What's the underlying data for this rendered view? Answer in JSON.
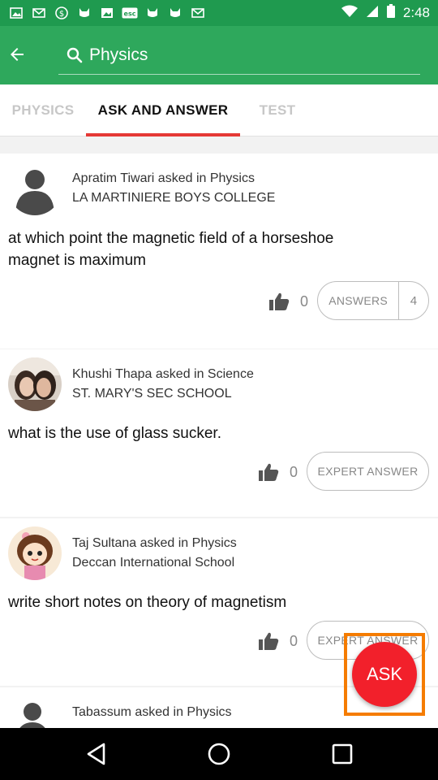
{
  "status_bar": {
    "time": "2:48",
    "left_icons": [
      "gallery-icon",
      "mail-icon",
      "dollar-icon",
      "cat-icon",
      "photo-icon",
      "esc-icon",
      "cat-icon",
      "cat-icon",
      "mail-icon"
    ],
    "right_icons": [
      "wifi-icon",
      "signal-icon",
      "battery-icon"
    ]
  },
  "search": {
    "value": "Physics",
    "placeholder": "Physics"
  },
  "tabs": [
    {
      "label": "PHYSICS",
      "active": false
    },
    {
      "label": "ASK AND ANSWER",
      "active": true
    },
    {
      "label": "TEST",
      "active": false
    }
  ],
  "colors": {
    "status_bar": "#1f9a4f",
    "app_bar": "#2ea85c",
    "tab_indicator": "#e53935",
    "ask_button": "#f2202b",
    "highlight_frame": "#f57c00"
  },
  "posts": [
    {
      "asker": "Apratim Tiwari asked in Physics",
      "school": "LA MARTINIERE BOYS COLLEGE",
      "question_line1": "at which point the magnetic field of a horseshoe",
      "question_line2": "magnet is maximum",
      "likes": "0",
      "answers_label": "ANSWERS",
      "answers_count": "4",
      "avatar": "default-person-icon"
    },
    {
      "asker": "Khushi Thapa asked in Science",
      "school": "ST. MARY'S SEC SCHOOL",
      "question": "what is the use of glass sucker.",
      "likes": "0",
      "button_label": "EXPERT ANSWER",
      "avatar": "photo-avatar"
    },
    {
      "asker": "Taj Sultana asked in Physics",
      "school": "Deccan International School",
      "question": "write short notes on theory of magnetism",
      "likes": "0",
      "button_label": "EXPERT ANSWER",
      "avatar": "cartoon-girl-avatar"
    },
    {
      "asker": "Tabassum asked in Physics",
      "avatar": "default-person-icon"
    }
  ],
  "ask_button": {
    "label": "ASK"
  },
  "nav_bar": {
    "icons": [
      "back-triangle-icon",
      "home-circle-icon",
      "recents-square-icon"
    ]
  }
}
